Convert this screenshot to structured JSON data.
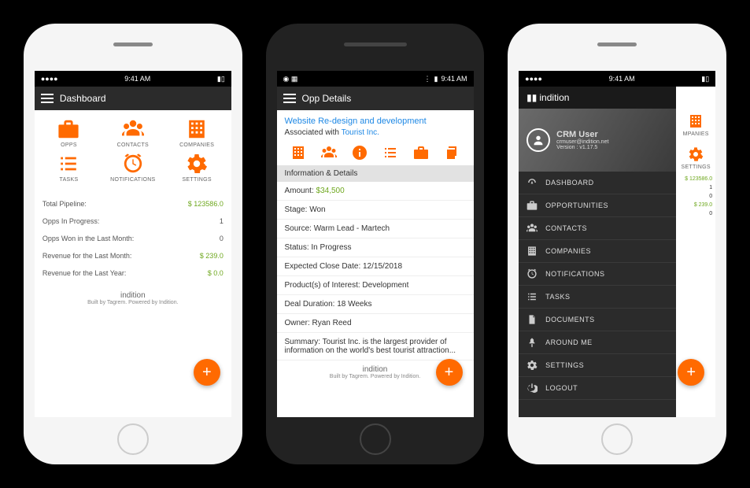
{
  "statusbar": {
    "time": "9:41 AM"
  },
  "phone1": {
    "title": "Dashboard",
    "grid": [
      {
        "label": "OPPS"
      },
      {
        "label": "CONTACTS"
      },
      {
        "label": "COMPANIES"
      },
      {
        "label": "TASKS"
      },
      {
        "label": "NOTIFICATIONS"
      },
      {
        "label": "SETTINGS"
      }
    ],
    "stats": [
      {
        "label": "Total Pipeline:",
        "value": "$ 123586.0",
        "green": true
      },
      {
        "label": "Opps In Progress:",
        "value": "1",
        "green": false
      },
      {
        "label": "Opps Won in the Last Month:",
        "value": "0",
        "green": false
      },
      {
        "label": "Revenue for the Last Month:",
        "value": "$ 239.0",
        "green": true
      },
      {
        "label": "Revenue for the Last Year:",
        "value": "$ 0.0",
        "green": true
      }
    ],
    "footer_brand": "indition",
    "footer_text": "Built by Tagrem. Powered by Indition."
  },
  "phone2": {
    "title": "Opp Details",
    "opp_title": "Website Re-design and development",
    "assoc_prefix": "Associated with ",
    "assoc_link": "Tourist Inc.",
    "section": "Information & Details",
    "fields": {
      "amount_label": "Amount: ",
      "amount_value": "$34,500",
      "stage": "Stage: Won",
      "source": "Source: Warm Lead - Martech",
      "status": "Status: In Progress",
      "close": "Expected Close Date: 12/15/2018",
      "product": "Product(s) of Interest: Development",
      "duration": "Deal Duration: 18 Weeks",
      "owner": "Owner: Ryan Reed",
      "summary": "Summary: Tourist Inc. is the largest provider of information on the world's best tourist attraction..."
    },
    "footer_brand": "indition",
    "footer_text": "Built by Tagrem. Powered by Indition."
  },
  "phone3": {
    "brand": "indition",
    "user_name": "CRM User",
    "user_email": "crmuser@indition.net",
    "user_version": "Version : v1.17.5",
    "menu": [
      {
        "label": "DASHBOARD"
      },
      {
        "label": "OPPORTUNITIES"
      },
      {
        "label": "CONTACTS"
      },
      {
        "label": "COMPANIES"
      },
      {
        "label": "NOTIFICATIONS"
      },
      {
        "label": "TASKS"
      },
      {
        "label": "DOCUMENTS"
      },
      {
        "label": "AROUND ME"
      },
      {
        "label": "SETTINGS"
      },
      {
        "label": "LOGOUT"
      }
    ],
    "behind": {
      "grid": [
        {
          "label": "MPANIES"
        },
        {
          "label": "SETTINGS"
        }
      ],
      "stats": [
        "$ 123586.0",
        "1",
        "0",
        "$ 239.0",
        "0"
      ]
    }
  }
}
